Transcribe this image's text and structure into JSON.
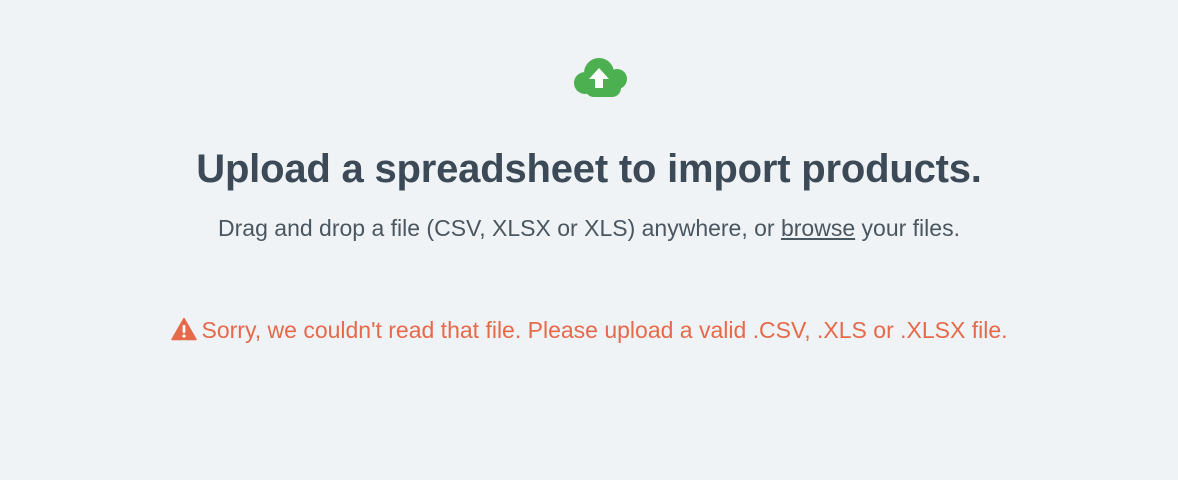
{
  "upload": {
    "icon": "cloud-upload-icon",
    "title": "Upload a spreadsheet to import products.",
    "subtitle_before": "Drag and drop a file (CSV, XLSX or XLS) anywhere, or ",
    "browse_label": "browse",
    "subtitle_after": " your files."
  },
  "error": {
    "icon": "warning-icon",
    "message": "Sorry, we couldn't read that file. Please upload a valid .CSV, .XLS or .XLSX file."
  },
  "colors": {
    "background": "#f0f3f5",
    "icon_green": "#4caf50",
    "title": "#3b4a56",
    "body_text": "#4a5660",
    "error": "#e5694a"
  }
}
